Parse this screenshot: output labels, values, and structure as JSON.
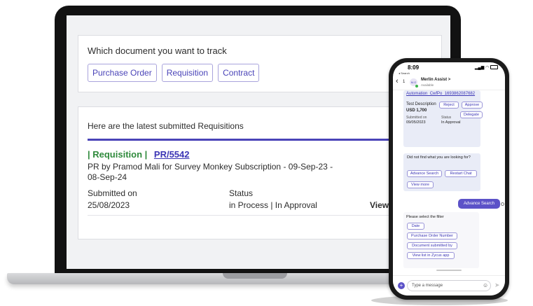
{
  "track_card": {
    "question": "Which document you want to track",
    "options": [
      "Purchase Order",
      "Requisition",
      "Contract"
    ]
  },
  "requisitions_card": {
    "title": "Here are the latest submitted Requisitions",
    "item": {
      "type_label": "| Requisition |",
      "id": "PR/5542",
      "description": "PR by Pramod Mali for Survey Monkey Subscription - 09-Sep-23 - 08-Sep-24",
      "submitted_label": "Submitted on",
      "submitted_value": "25/08/2023",
      "status_label": "Status",
      "status_value": "in Process | In Approval",
      "view_label": "View"
    }
  },
  "phone": {
    "time": "8:09",
    "back_label": "◂ Search",
    "header": {
      "back_count": "1",
      "avatar_initials": "M.G",
      "bot_name": "Merlin Assist >",
      "bot_status": "Available"
    },
    "doc_bubble": {
      "link": "Automation_CwfPo_1693862087682",
      "description": "Test Description",
      "amount": "USD 1,700",
      "submitted_label": "Submitted on",
      "submitted_value": "09/05/2023",
      "status_label": "Status",
      "status_value": "In Approval",
      "reject": "Reject",
      "approve": "Approve",
      "delegate": "Delegate"
    },
    "not_found": {
      "text": "Did not find what you are looking for?",
      "advance_search": "Advance Search",
      "restart_chat": "Restart Chat",
      "view_more": "View more"
    },
    "user_message": "Advance Search",
    "filter": {
      "prompt": "Please select the filter",
      "options": [
        "Date",
        "Purchase Order Number",
        "Document submitted by",
        "View list in Zycus app"
      ]
    },
    "input_placeholder": "Type a message"
  },
  "colors": {
    "accent": "#4a44b8",
    "link": "#3b35b5",
    "requisition_tag": "#2f8a3c",
    "chat_bubble": "#e9ecf7",
    "user_bubble": "#5c52c8"
  }
}
